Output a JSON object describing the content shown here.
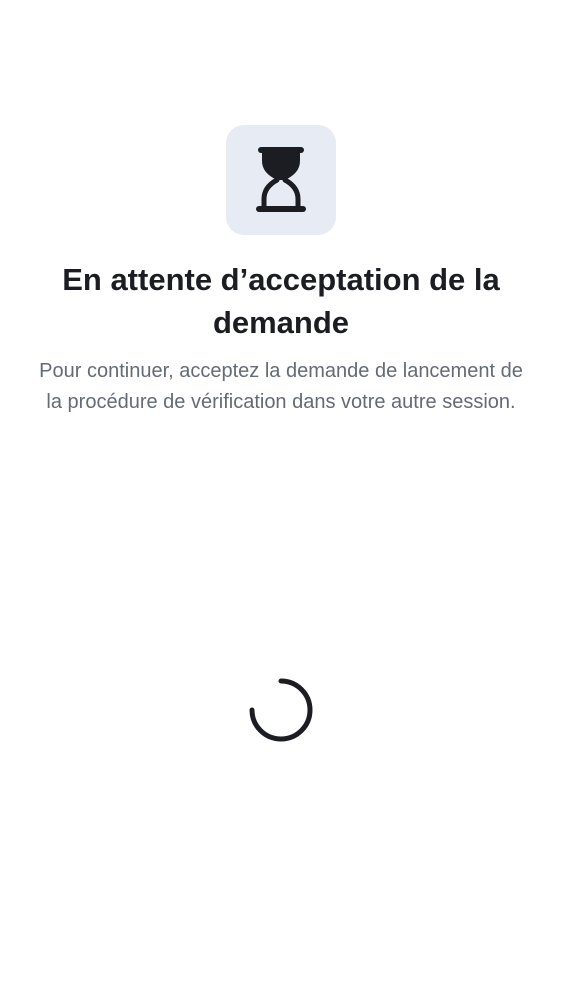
{
  "header": {
    "icon": "hourglass-icon"
  },
  "main": {
    "title": "En attente d’acceptation de la demande",
    "description": "Pour continuer, acceptez la demande de lancement de la procédure de vérification dans votre autre session."
  },
  "loading": {
    "indicator": "loading-spinner"
  },
  "colors": {
    "background": "#ffffff",
    "icon_tile": "#e7ebf3",
    "title_text": "#1b1d22",
    "body_text": "#646b74"
  }
}
